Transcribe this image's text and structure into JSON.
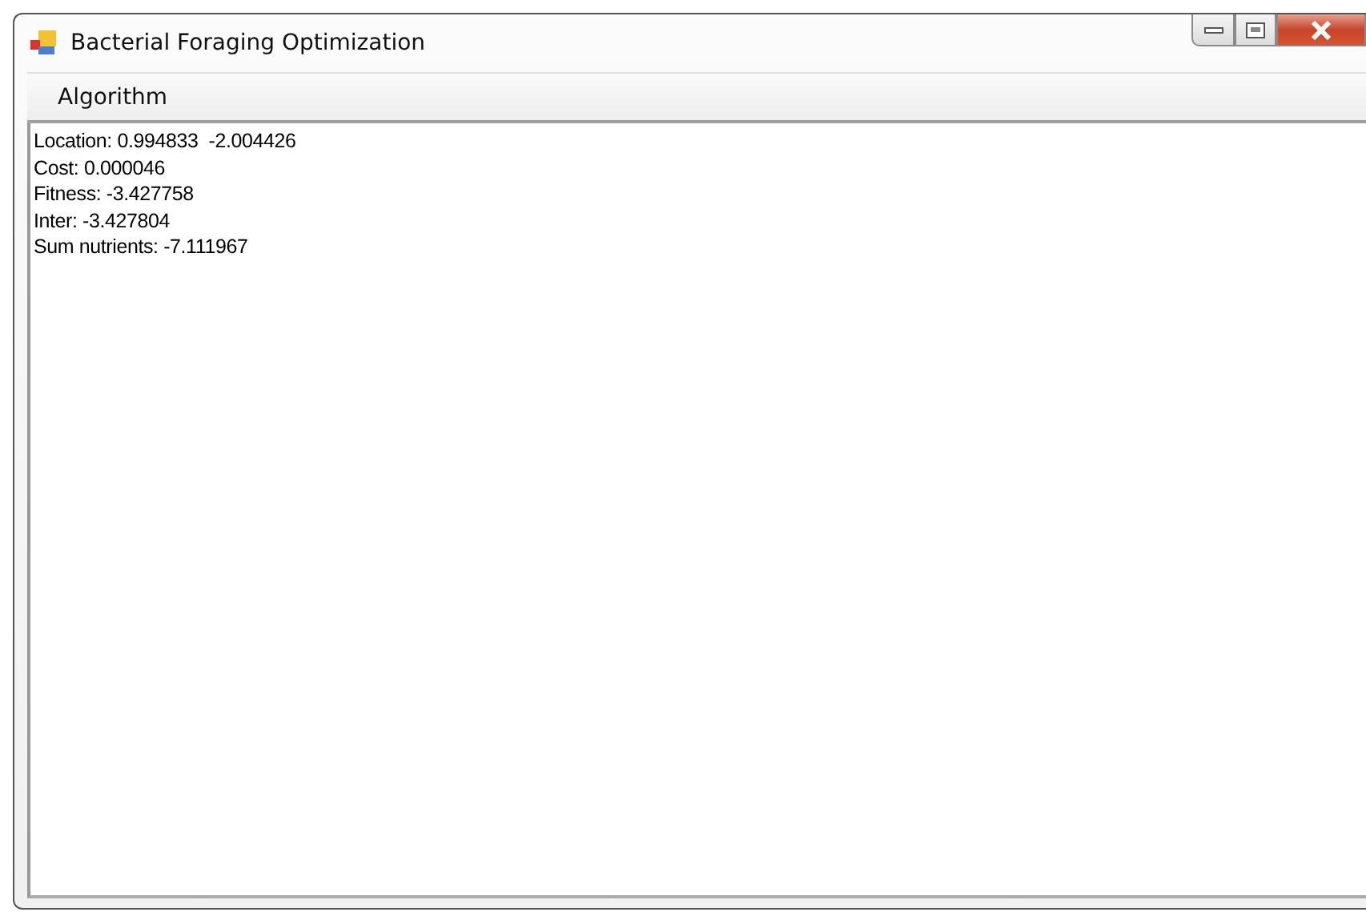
{
  "window": {
    "title": "Bacterial Foraging Optimization"
  },
  "menu": [
    "Algorithm"
  ],
  "output": [
    "Location: 0.994833  -2.004426",
    "Cost: 0.000046",
    "Fitness: -3.427758",
    "Inter: -3.427804",
    "Sum nutrients: -7.111967"
  ]
}
